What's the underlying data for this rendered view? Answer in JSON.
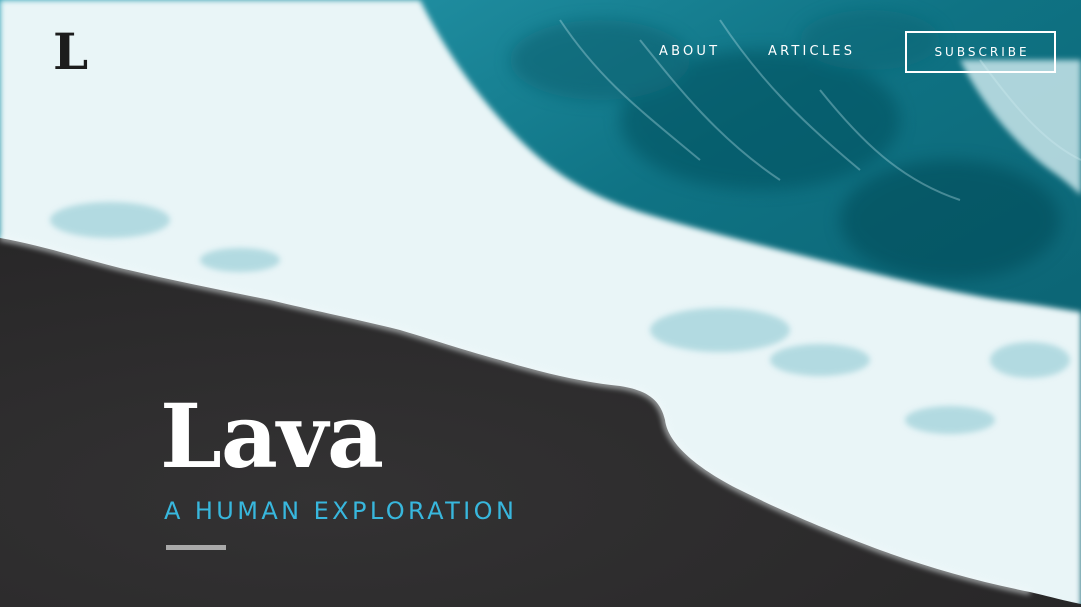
{
  "brand": {
    "logo_letter": "L"
  },
  "nav": {
    "items": [
      {
        "label": "ABOUT"
      },
      {
        "label": "ARTICLES"
      }
    ],
    "subscribe_label": "SUBSCRIBE"
  },
  "hero": {
    "title": "Lava",
    "subtitle": "A HUMAN EXPLORATION",
    "background": {
      "subject": "ocean-waves-on-black-sand-beach",
      "sand_color": "#2b2a2b",
      "ocean_color": "#0f6f7f",
      "foam_color": "#eef7f8"
    }
  },
  "colors": {
    "accent": "#38b7dd",
    "text_light": "#ffffff",
    "logo_dark": "#1c1c1c",
    "divider": "#a9a9a9"
  }
}
